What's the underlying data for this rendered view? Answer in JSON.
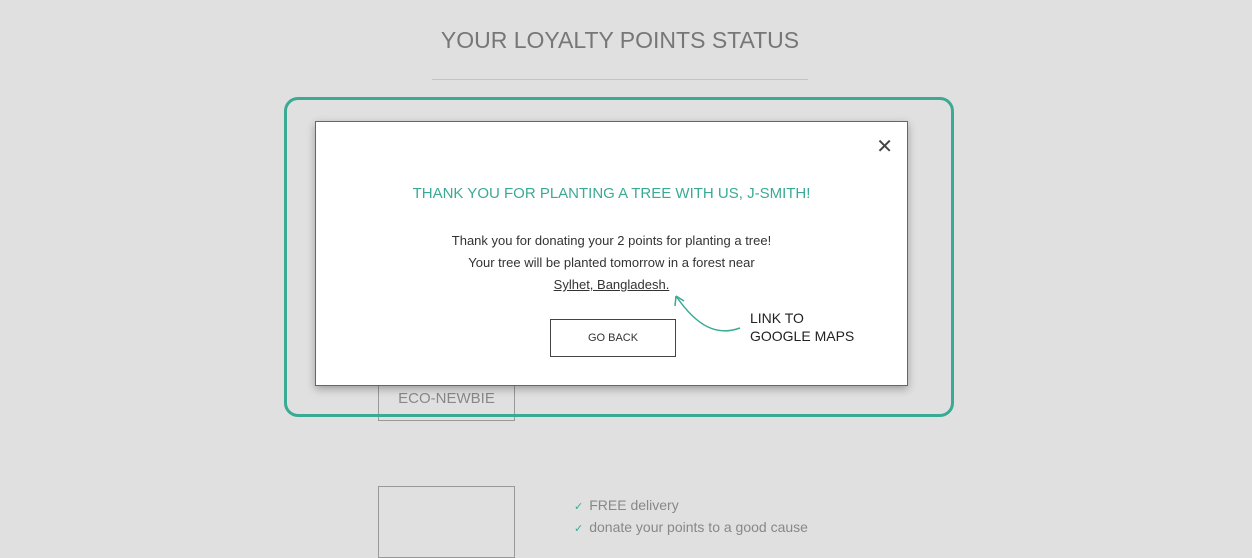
{
  "page": {
    "title": "YOUR LOYALTY POINTS STATUS"
  },
  "tier": {
    "label": "ECO-NEWBIE"
  },
  "benefits": [
    "FREE delivery",
    "donate your points to a good cause"
  ],
  "modal": {
    "title": "THANK YOU FOR PLANTING A TREE WITH US, J-SMITH!",
    "line1": "Thank you for donating your 2 points for planting a tree!",
    "line2": "Your tree will be planted tomorrow in a forest near",
    "location_link": "Sylhet, Bangladesh.",
    "button": "GO BACK",
    "close_icon": "close-icon"
  },
  "annotation": {
    "line1": "LINK TO",
    "line2": "GOOGLE MAPS"
  },
  "colors": {
    "accent": "#3aaa94",
    "background": "#e0e0e0"
  }
}
